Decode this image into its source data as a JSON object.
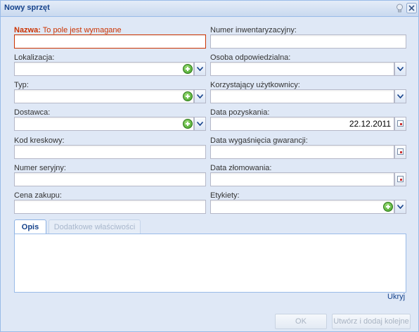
{
  "window": {
    "title": "Nowy sprzęt"
  },
  "icons": {
    "help": "lightbulb-icon",
    "close": "close-icon",
    "add": "green-plus-icon",
    "dropdown": "chevron-down-icon",
    "calendar": "calendar-icon"
  },
  "colors": {
    "invalid": "#cc3300",
    "title": "#15428b",
    "add": "#3e9c24"
  },
  "form": {
    "name": {
      "label": "Nazwa:",
      "error": " To pole jest wymagane",
      "value": ""
    },
    "inventory_number": {
      "label": "Numer inwentaryzacyjny:",
      "value": ""
    },
    "location": {
      "label": "Lokalizacja:",
      "value": ""
    },
    "responsible_person": {
      "label": "Osoba odpowiedzialna:",
      "value": ""
    },
    "type": {
      "label": "Typ:",
      "value": ""
    },
    "users": {
      "label": "Korzystający użytkownicy:",
      "value": ""
    },
    "supplier": {
      "label": "Dostawca:",
      "value": ""
    },
    "acquisition_date": {
      "label": "Data pozyskania:",
      "value": "22.12.2011"
    },
    "barcode": {
      "label": "Kod kreskowy:",
      "value": ""
    },
    "warranty_end_date": {
      "label": "Data wygaśnięcia gwarancji:",
      "value": ""
    },
    "serial_number": {
      "label": "Numer seryjny:",
      "value": ""
    },
    "scrap_date": {
      "label": "Data złomowania:",
      "value": ""
    },
    "purchase_price": {
      "label": "Cena zakupu:",
      "value": ""
    },
    "labels": {
      "label": "Etykiety:",
      "value": ""
    }
  },
  "tabs": [
    {
      "label": "Opis",
      "active": true
    },
    {
      "label": "Dodatkowe właściwości",
      "active": false
    }
  ],
  "description": {
    "value": ""
  },
  "hide_link": "Ukryj",
  "buttons": {
    "ok": "OK",
    "create_and_add": "Utwórz i dodaj kolejne"
  }
}
